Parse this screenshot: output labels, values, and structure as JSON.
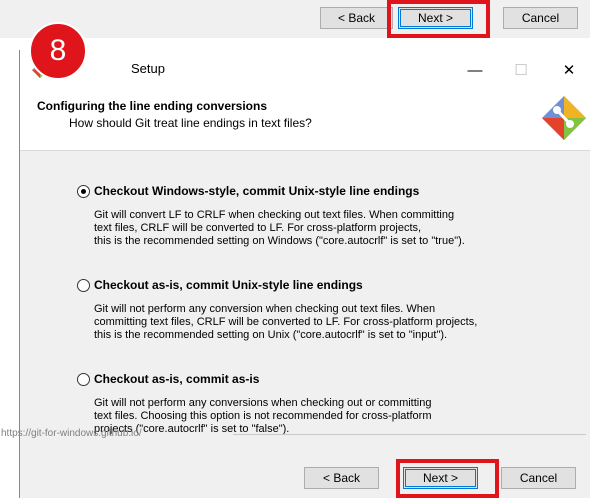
{
  "previous_step": {
    "back_label": "< Back",
    "next_label": "Next >",
    "cancel_label": "Cancel"
  },
  "step_badge": "8",
  "window": {
    "title": "Setup",
    "controls": {
      "minimize": "—",
      "maximize": "☐",
      "close": "✕"
    }
  },
  "header": {
    "title": "Configuring the line ending conversions",
    "subtitle": "How should Git treat line endings in text files?"
  },
  "options": [
    {
      "label": "Checkout Windows-style, commit Unix-style line endings",
      "selected": true,
      "description": [
        "Git will convert LF to CRLF when checking out text files. When committing",
        "text files, CRLF will be converted to LF. For cross-platform projects,",
        "this is the recommended setting on Windows (\"core.autocrlf\" is set to \"true\")."
      ]
    },
    {
      "label": "Checkout as-is, commit Unix-style line endings",
      "selected": false,
      "description": [
        "Git will not perform any conversion when checking out text files. When",
        "committing text files, CRLF will be converted to LF. For cross-platform projects,",
        "this is the recommended setting on Unix (\"core.autocrlf\" is set to \"input\")."
      ]
    },
    {
      "label": "Checkout as-is, commit as-is",
      "selected": false,
      "description": [
        "Git will not perform any conversions when checking out or committing",
        "text files. Choosing this option is not recommended for cross-platform",
        "projects (\"core.autocrlf\" is set to \"false\")."
      ]
    }
  ],
  "footer": {
    "url": "https://git-for-windows.github.io/",
    "back_label": "< Back",
    "next_label": "Next >",
    "cancel_label": "Cancel"
  },
  "colors": {
    "highlight": "#e0141b",
    "focus": "#0078d7"
  }
}
